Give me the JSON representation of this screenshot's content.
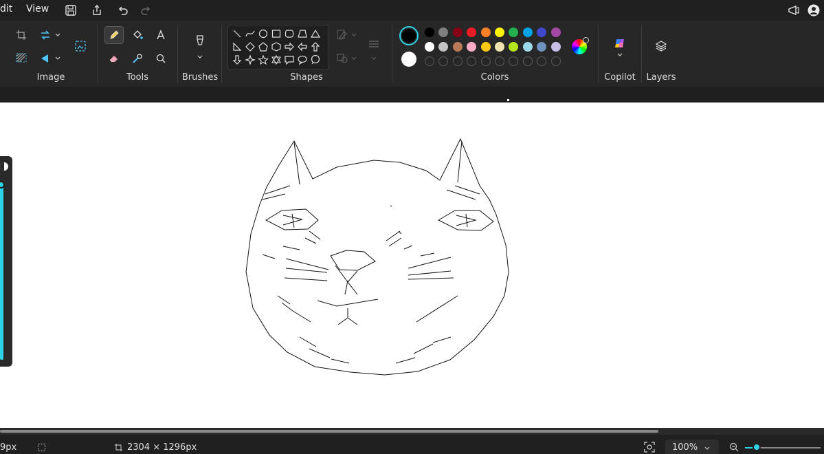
{
  "menu": {
    "edit": "dit",
    "view": "View"
  },
  "ribbon": {
    "groups": {
      "image": "Image",
      "tools": "Tools",
      "brushes": "Brushes",
      "shapes": "Shapes",
      "colors": "Colors",
      "copilot": "Copilot",
      "layers": "Layers"
    }
  },
  "colors": {
    "current_primary": "#000000",
    "current_secondary": "#ffffff",
    "row1": [
      "#000000",
      "#7f7f7f",
      "#880015",
      "#ed1c24",
      "#ff7f27",
      "#fff200",
      "#22b14c",
      "#00a2e8",
      "#3f48cc",
      "#a349a4"
    ],
    "row2": [
      "#ffffff",
      "#c3c3c3",
      "#b97a57",
      "#ffaec9",
      "#ffc90e",
      "#efe4b0",
      "#b5e61d",
      "#99d9ea",
      "#7092be",
      "#c8bfe7"
    ]
  },
  "status": {
    "cursor_position": "9px",
    "canvas_size": "2304 × 1296px",
    "zoom": "100%"
  },
  "accent": "#2fd3e6"
}
